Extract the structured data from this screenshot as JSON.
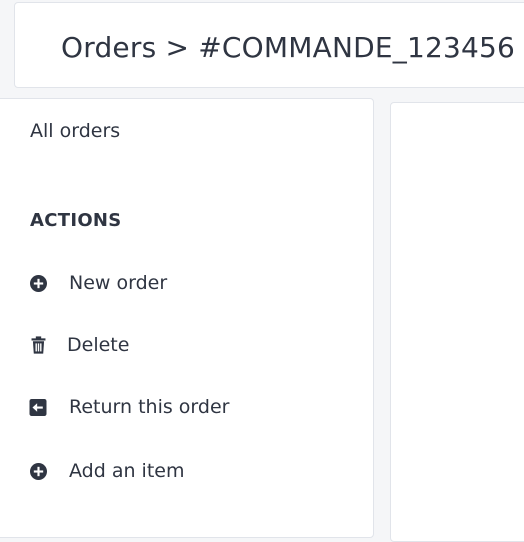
{
  "header": {
    "breadcrumb": "Orders > #COMMANDE_123456"
  },
  "sidebar": {
    "all_orders_link": "All orders",
    "actions_heading": "ACTIONS",
    "actions": [
      {
        "label": "New order",
        "icon": "plus-circle-icon"
      },
      {
        "label": "Delete",
        "icon": "trash-icon"
      },
      {
        "label": "Return this order",
        "icon": "return-arrow-icon"
      },
      {
        "label": "Add an item",
        "icon": "plus-circle-icon"
      }
    ]
  },
  "colors": {
    "text": "#2f3542",
    "icon": "#2f3542",
    "panel_background": "#ffffff",
    "page_background": "#f5f6f8",
    "border": "#e1e4ea"
  }
}
